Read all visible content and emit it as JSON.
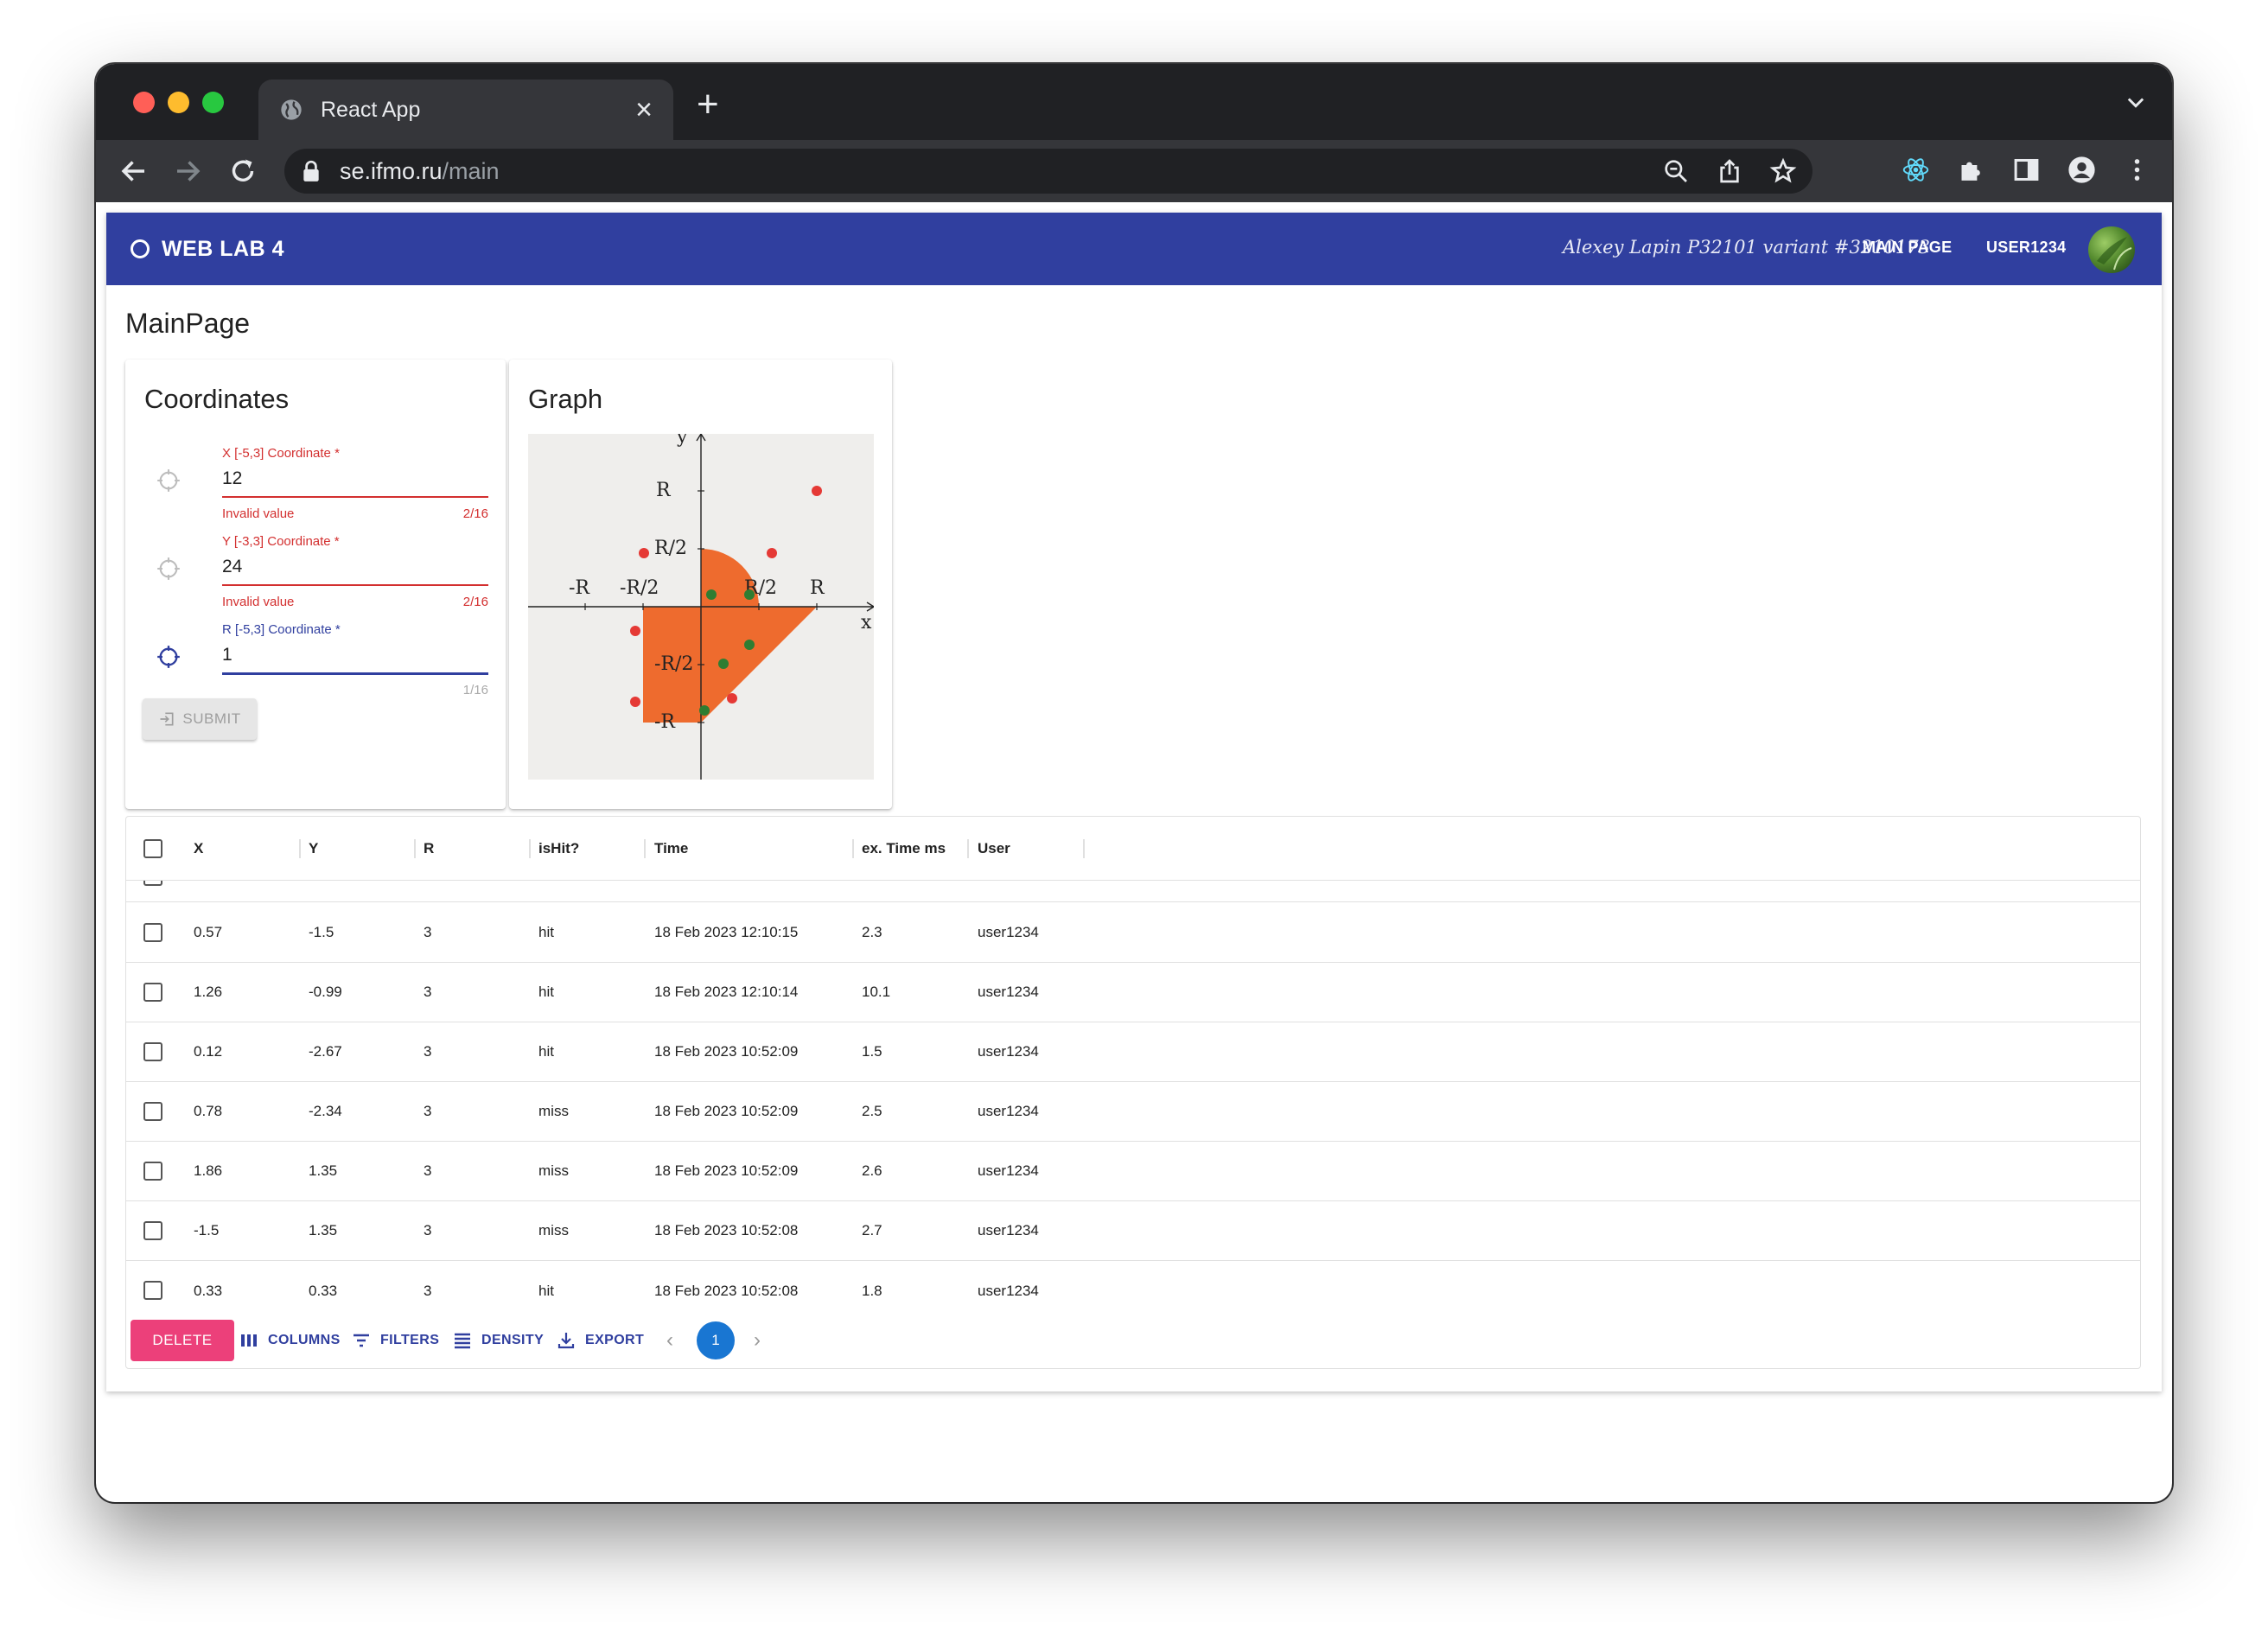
{
  "browser": {
    "tab_title": "React App",
    "url_host": "se.ifmo.ru",
    "url_path": "/main"
  },
  "appbar": {
    "brand": "WEB LAB 4",
    "author": "Alexey Lapin P32101 variant #3210173",
    "nav_main": "MAIN PAGE",
    "nav_user": "USER1234"
  },
  "page": {
    "title": "MainPage"
  },
  "coords": {
    "title": "Coordinates",
    "x": {
      "label": "X [-5,3] Coordinate *",
      "value": "12",
      "helper": "Invalid value",
      "count": "2/16"
    },
    "y": {
      "label": "Y [-3,3] Coordinate *",
      "value": "24",
      "helper": "Invalid value",
      "count": "2/16"
    },
    "r": {
      "label": "R [-5,3] Coordinate *",
      "value": "1",
      "helper": "",
      "count": "1/16"
    },
    "submit": "SUBMIT"
  },
  "graph": {
    "title": "Graph",
    "labels": {
      "y": "y",
      "x": "x",
      "R_top": "R",
      "R2_top": "R/2",
      "negR_left": "-R",
      "negR2_left": "-R/2",
      "R2_right": "R/2",
      "R_right": "R",
      "negR2_bottom": "-R/2",
      "negR_bottom": "-R"
    },
    "colors": {
      "area": "#ee6b2e",
      "hit": "#2e7d32",
      "miss": "#e53935",
      "background": "#efeeec"
    }
  },
  "table": {
    "columns": [
      "X",
      "Y",
      "R",
      "isHit?",
      "Time",
      "ex. Time ms",
      "User"
    ],
    "rows": [
      [
        "0.57",
        "-1.5",
        "3",
        "hit",
        "18 Feb 2023 12:10:15",
        "2.3",
        "user1234"
      ],
      [
        "1.26",
        "-0.99",
        "3",
        "hit",
        "18 Feb 2023 12:10:14",
        "10.1",
        "user1234"
      ],
      [
        "0.12",
        "-2.67",
        "3",
        "hit",
        "18 Feb 2023 10:52:09",
        "1.5",
        "user1234"
      ],
      [
        "0.78",
        "-2.34",
        "3",
        "miss",
        "18 Feb 2023 10:52:09",
        "2.5",
        "user1234"
      ],
      [
        "1.86",
        "1.35",
        "3",
        "miss",
        "18 Feb 2023 10:52:09",
        "2.6",
        "user1234"
      ],
      [
        "-1.5",
        "1.35",
        "3",
        "miss",
        "18 Feb 2023 10:52:08",
        "2.7",
        "user1234"
      ],
      [
        "0.33",
        "0.33",
        "3",
        "hit",
        "18 Feb 2023 10:52:08",
        "1.8",
        "user1234"
      ]
    ]
  },
  "footer": {
    "delete": "DELETE",
    "columns": "COLUMNS",
    "filters": "FILTERS",
    "density": "DENSITY",
    "export": "EXPORT",
    "page": "1"
  },
  "icons": [
    "globe-icon",
    "close-icon",
    "plus-icon",
    "chevron-down-icon",
    "back-arrow-icon",
    "forward-arrow-icon",
    "reload-icon",
    "lock-icon",
    "zoom-icon",
    "share-icon",
    "star-icon",
    "react-devtools-icon",
    "puzzle-icon",
    "sidepanel-icon",
    "profile-icon",
    "kebab-menu-icon",
    "crosshair-icon",
    "login-icon",
    "columns-icon",
    "filter-icon",
    "density-icon",
    "download-icon"
  ]
}
